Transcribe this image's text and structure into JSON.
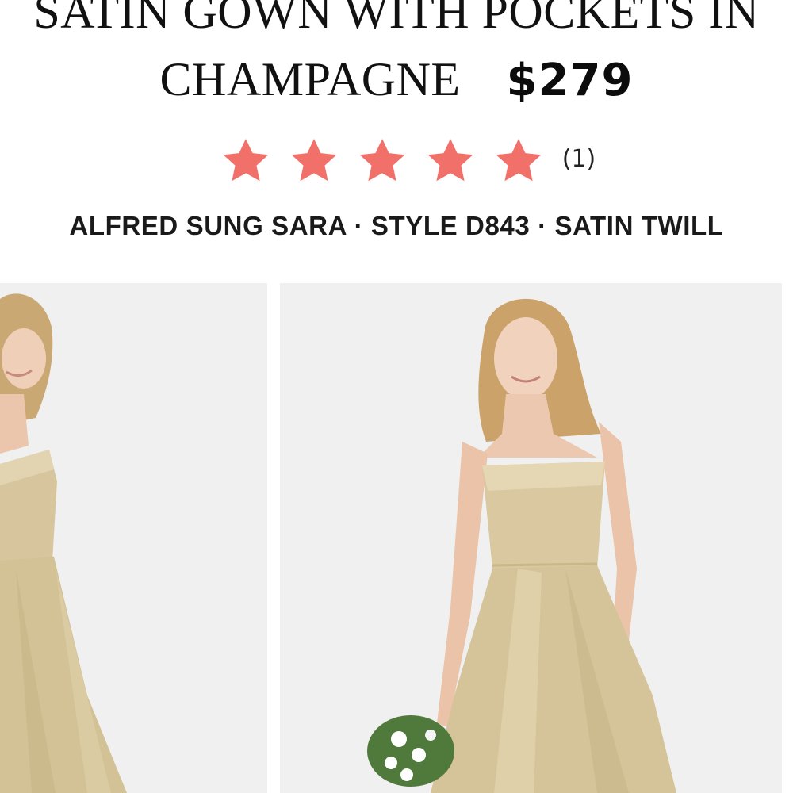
{
  "product": {
    "title_line1": "SATIN GOWN WITH POCKETS IN",
    "title_line2": "CHAMPAGNE",
    "price": "$279",
    "rating": {
      "stars": 5,
      "max": 5,
      "review_count": "(1)",
      "star_color": "#f2706a"
    },
    "meta": "ALFRED SUNG SARA · STYLE D843 · SATIN TWILL"
  },
  "gallery": {
    "background_color": "#f0f0f0",
    "dress_color": "#d8c8a0",
    "images": [
      {
        "icon": "product-photo-side-view"
      },
      {
        "icon": "product-photo-front-view"
      }
    ]
  }
}
